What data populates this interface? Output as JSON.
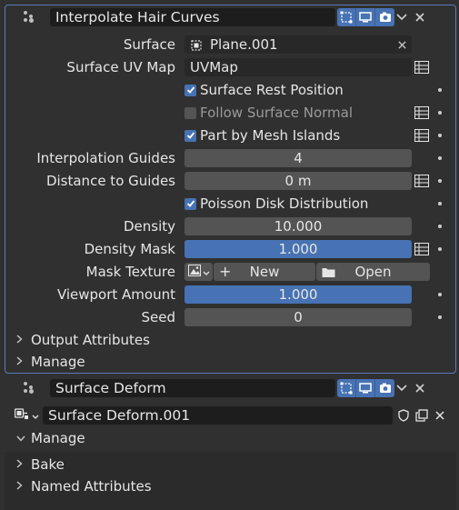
{
  "modifier1": {
    "name": "Interpolate Hair Curves",
    "icons": {
      "drag": "drag-dots-icon",
      "edit_mode": "edit-mode-icon",
      "viewport": "monitor-icon",
      "render": "camera-icon",
      "dropdown": "chevron-down-icon",
      "close": "close-icon"
    },
    "surface_label": "Surface",
    "surface_value": "Plane.001",
    "surface_uv_label": "Surface UV Map",
    "surface_uv_value": "UVMap",
    "surface_rest_label": "Surface Rest Position",
    "surface_rest_checked": true,
    "follow_normal_label": "Follow Surface Normal",
    "follow_normal_checked": false,
    "part_islands_label": "Part by Mesh Islands",
    "part_islands_checked": true,
    "interp_guides_label": "Interpolation Guides",
    "interp_guides_value": "4",
    "distance_label": "Distance to Guides",
    "distance_value": "0 m",
    "poisson_label": "Poisson Disk Distribution",
    "poisson_checked": true,
    "density_label": "Density",
    "density_value": "10.000",
    "density_mask_label": "Density Mask",
    "density_mask_value": "1.000",
    "density_mask_fill": 1.0,
    "mask_texture_label": "Mask Texture",
    "new_label": "New",
    "open_label": "Open",
    "viewport_amount_label": "Viewport Amount",
    "viewport_amount_value": "1.000",
    "viewport_amount_fill": 1.0,
    "seed_label": "Seed",
    "seed_value": "0",
    "output_attrs_label": "Output Attributes",
    "manage_label": "Manage"
  },
  "modifier2": {
    "name": "Surface Deform",
    "node_group": "Surface Deform.001",
    "manage_label": "Manage",
    "bake_label": "Bake",
    "named_attrs_label": "Named Attributes"
  },
  "colors": {
    "accent": "#4772b3",
    "panel_border": "#5d7ab8",
    "background": "#303030"
  }
}
